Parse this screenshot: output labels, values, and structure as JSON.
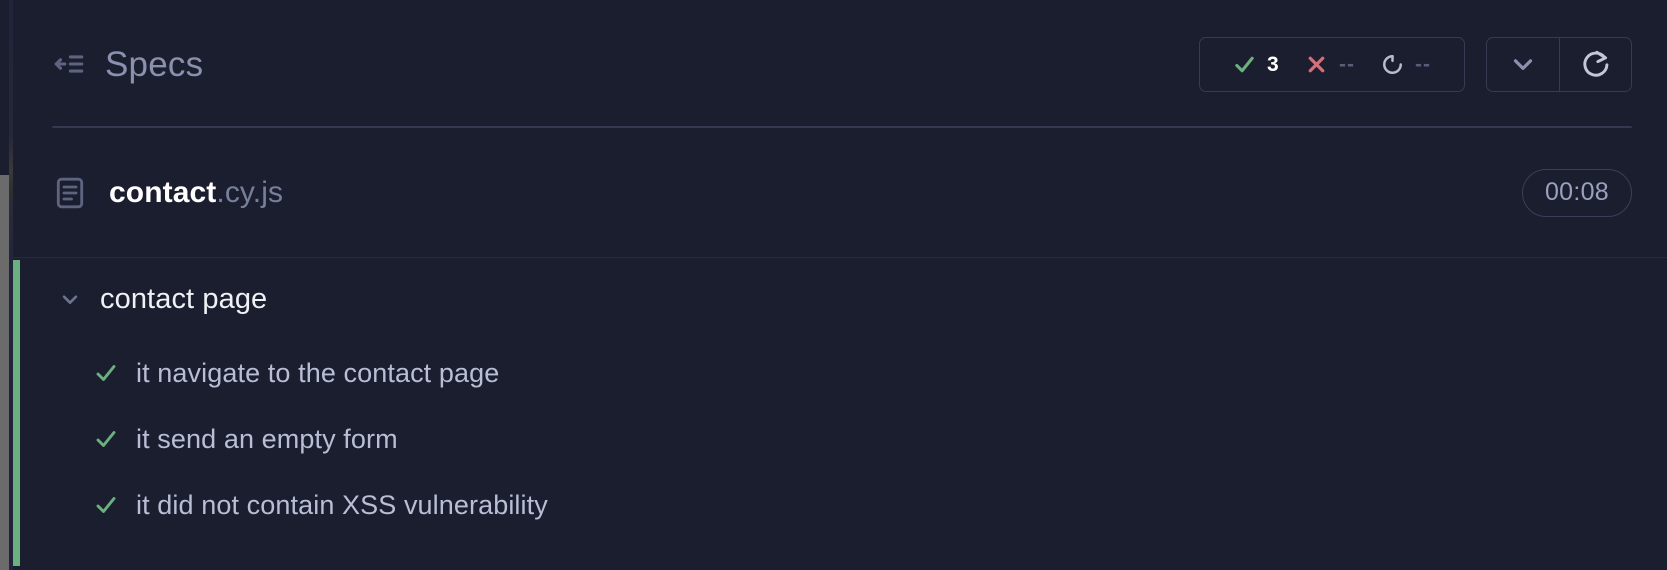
{
  "theme": {
    "background": "#1b1e2e",
    "accent_pass": "#6bb17f",
    "accent_fail": "#d0707a",
    "accent_pending": "#b8bcd0",
    "text_primary": "#ffffff",
    "text_secondary": "#b9bed6",
    "text_muted": "#8a90ad",
    "border": "#363a52",
    "status_bar": "#6bb17f"
  },
  "header": {
    "back_icon": "arrow-left-collapse-icon",
    "title": "Specs",
    "stats": [
      {
        "icon": "check-icon",
        "name": "passed",
        "value": "3",
        "kind": "num",
        "color": "#6bb17f"
      },
      {
        "icon": "x-icon",
        "name": "failed",
        "value": "--",
        "kind": "dash",
        "color": "#d0707a"
      },
      {
        "icon": "circle-arrow-icon",
        "name": "pending",
        "value": "--",
        "kind": "dash",
        "color": "#b8bcd0"
      }
    ],
    "buttons": [
      {
        "icon": "chevron-down-icon",
        "name": "expand-options-button"
      },
      {
        "icon": "refresh-icon",
        "name": "rerun-button"
      }
    ]
  },
  "spec": {
    "icon": "file-document-icon",
    "name_base": "contact",
    "name_ext": ".cy.js",
    "duration": "00:08"
  },
  "results": {
    "status": "passed",
    "suite": {
      "chevron": "chevron-down-icon",
      "title": "contact page",
      "expanded": true
    },
    "tests": [
      {
        "state": "passed",
        "icon": "check-icon",
        "label": "it navigate to the contact page"
      },
      {
        "state": "passed",
        "icon": "check-icon",
        "label": "it send an empty form"
      },
      {
        "state": "passed",
        "icon": "check-icon",
        "label": "it did not contain XSS vulnerability"
      }
    ]
  }
}
